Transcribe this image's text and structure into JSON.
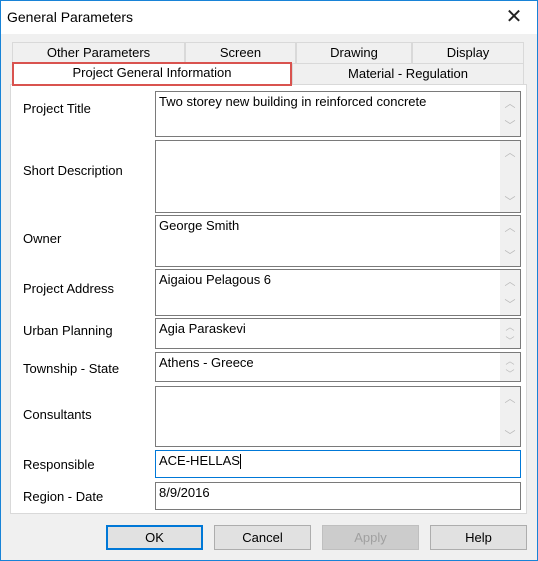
{
  "window": {
    "title": "General Parameters",
    "close_icon": "close-icon"
  },
  "tabs": {
    "row1": [
      "Other Parameters",
      "Screen",
      "Drawing",
      "Display"
    ],
    "row2": [
      "Project General Information",
      "Material - Regulation"
    ],
    "active": "Project General Information",
    "highlight_color": "#d9534f"
  },
  "fields": [
    {
      "label": "Project Title",
      "value": "Two storey new building in reinforced concrete"
    },
    {
      "label": "Short Description",
      "value": ""
    },
    {
      "label": "Owner",
      "value": "George Smith"
    },
    {
      "label": "Project Address",
      "value": "Aigaiou Pelagous 6"
    },
    {
      "label": "Urban Planning",
      "value": "Agia Paraskevi"
    },
    {
      "label": "Township - State",
      "value": "Athens - Greece"
    },
    {
      "label": "Consultants",
      "value": ""
    },
    {
      "label": "Responsible",
      "value": "ACE-HELLAS"
    },
    {
      "label": "Region - Date",
      "value": "8/9/2016"
    }
  ],
  "buttons": {
    "ok": "OK",
    "cancel": "Cancel",
    "apply": "Apply",
    "help": "Help"
  }
}
